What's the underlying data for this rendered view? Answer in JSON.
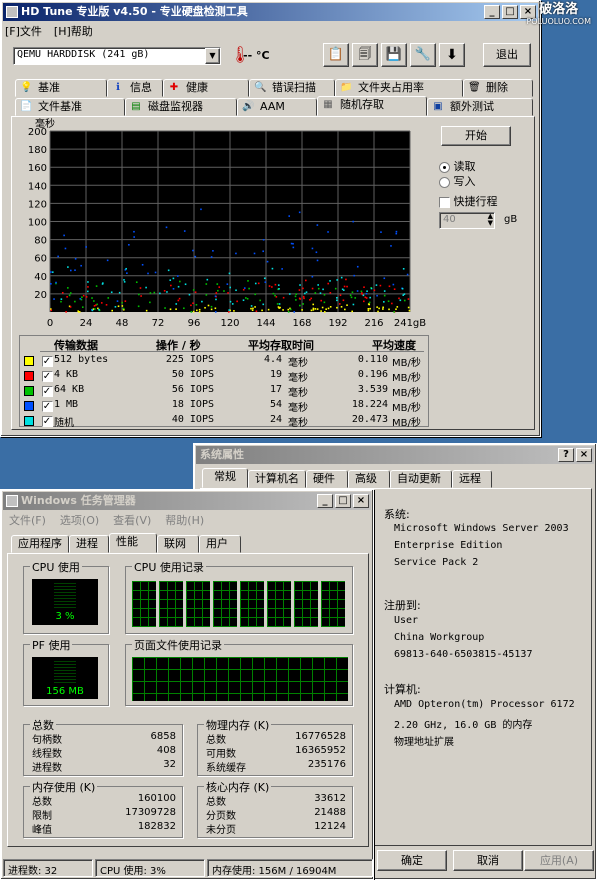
{
  "watermark": {
    "title": "破洛洛",
    "url": "POLUOLUO.COM"
  },
  "hdtune": {
    "title": "HD Tune 专业版 v4.50 - 专业硬盘检测工具",
    "menu": [
      "[F]文件",
      "[H]帮助"
    ],
    "drive": "QEMU HARDDISK (241 gB)",
    "temp": "-- °C",
    "exit_label": "退出",
    "tabs_top": [
      {
        "label": "基准",
        "icon": "💡"
      },
      {
        "label": "信息",
        "icon": "ℹ"
      },
      {
        "label": "健康",
        "icon": "✚"
      },
      {
        "label": "错误扫描",
        "icon": "🔍"
      },
      {
        "label": "文件夹占用率",
        "icon": "📁"
      },
      {
        "label": "删除",
        "icon": "🗑"
      }
    ],
    "tabs_bottom": [
      {
        "label": "文件基准",
        "icon": "📄"
      },
      {
        "label": "磁盘监视器",
        "icon": "▤"
      },
      {
        "label": "AAM",
        "icon": "🔊"
      },
      {
        "label": "随机存取",
        "icon": "▦"
      },
      {
        "label": "额外测试",
        "icon": "▣"
      }
    ],
    "start_label": "开始",
    "read_label": "读取",
    "write_label": "写入",
    "fast_label": "快捷行程",
    "fast_value": "40",
    "fast_unit": "gB",
    "table_headers": [
      "传输数据",
      "操作 / 秒",
      "平均存取时间",
      "平均速度"
    ],
    "table_rows": [
      {
        "color": "#ffff00",
        "label": "512 bytes",
        "ops": "225 IOPS",
        "time": "4.4",
        "time_unit": "毫秒",
        "speed": "0.110",
        "speed_unit": "MB/秒"
      },
      {
        "color": "#ff0000",
        "label": "4 KB",
        "ops": "50 IOPS",
        "time": "19",
        "time_unit": "毫秒",
        "speed": "0.196",
        "speed_unit": "MB/秒"
      },
      {
        "color": "#00c000",
        "label": "64 KB",
        "ops": "56 IOPS",
        "time": "17",
        "time_unit": "毫秒",
        "speed": "3.539",
        "speed_unit": "MB/秒"
      },
      {
        "color": "#0050ff",
        "label": "1 MB",
        "ops": "18 IOPS",
        "time": "54",
        "time_unit": "毫秒",
        "speed": "18.224",
        "speed_unit": "MB/秒"
      },
      {
        "color": "#00e0e0",
        "label": "随机",
        "ops": "40 IOPS",
        "time": "24",
        "time_unit": "毫秒",
        "speed": "20.473",
        "speed_unit": "MB/秒"
      }
    ]
  },
  "chart_data": {
    "type": "scatter",
    "ylabel": "毫秒",
    "xlabel": "",
    "y_ticks": [
      "200",
      "180",
      "160",
      "140",
      "120",
      "100",
      "80",
      "60",
      "40",
      "20"
    ],
    "x_ticks": [
      "0",
      "24",
      "48",
      "72",
      "96",
      "120",
      "144",
      "168",
      "192",
      "216",
      "241gB"
    ],
    "xlim": [
      0,
      241
    ],
    "ylim": [
      0,
      200
    ],
    "grid": true,
    "series": [
      {
        "name": "512 bytes",
        "color": "#ffff00",
        "mean_ms": 4.4
      },
      {
        "name": "4 KB",
        "color": "#ff0000",
        "mean_ms": 19
      },
      {
        "name": "64 KB",
        "color": "#00c000",
        "mean_ms": 17
      },
      {
        "name": "1 MB",
        "color": "#0050ff",
        "mean_ms": 54
      },
      {
        "name": "随机",
        "color": "#00e0e0",
        "mean_ms": 24
      }
    ]
  },
  "sysprops": {
    "title": "系统属性",
    "tabs": [
      "常规",
      "计算机名",
      "硬件",
      "高级",
      "自动更新",
      "远程"
    ],
    "system_label": "系统:",
    "system_lines": [
      "Microsoft Windows Server 2003",
      "Enterprise Edition",
      "Service Pack 2"
    ],
    "registered_label": "注册到:",
    "registered_lines": [
      "User",
      "China Workgroup",
      "69813-640-6503815-45137"
    ],
    "computer_label": "计算机:",
    "computer_lines": [
      "AMD Opteron(tm) Processor 6172",
      "2.20 GHz, 16.0 GB 的内存",
      "物理地址扩展"
    ],
    "ok": "确定",
    "cancel": "取消",
    "apply": "应用(A)"
  },
  "taskmgr": {
    "title": "Windows 任务管理器",
    "menu": [
      "文件(F)",
      "选项(O)",
      "查看(V)",
      "帮助(H)"
    ],
    "tabs": [
      "应用程序",
      "进程",
      "性能",
      "联网",
      "用户"
    ],
    "cpu_usage_label": "CPU 使用",
    "cpu_usage_value": "3 %",
    "cpu_history_label": "CPU 使用记录",
    "pf_usage_label": "PF 使用",
    "pf_usage_value": "156 MB",
    "pf_history_label": "页面文件使用记录",
    "totals": {
      "label": "总数",
      "rows": [
        [
          "句柄数",
          "6858"
        ],
        [
          "线程数",
          "408"
        ],
        [
          "进程数",
          "32"
        ]
      ]
    },
    "physical": {
      "label": "物理内存 (K)",
      "rows": [
        [
          "总数",
          "16776528"
        ],
        [
          "可用数",
          "16365952"
        ],
        [
          "系统缓存",
          "235176"
        ]
      ]
    },
    "commit": {
      "label": "内存使用 (K)",
      "rows": [
        [
          "总数",
          "160100"
        ],
        [
          "限制",
          "17309728"
        ],
        [
          "峰值",
          "182832"
        ]
      ]
    },
    "kernel": {
      "label": "核心内存 (K)",
      "rows": [
        [
          "总数",
          "33612"
        ],
        [
          "分页数",
          "21488"
        ],
        [
          "未分页",
          "12124"
        ]
      ]
    },
    "status": {
      "processes": "进程数: 32",
      "cpu": "CPU 使用: 3%",
      "mem": "内存使用: 156M / 16904M"
    }
  }
}
